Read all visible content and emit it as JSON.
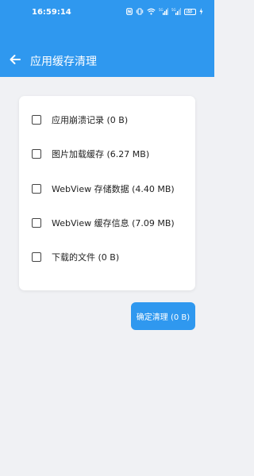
{
  "status_bar": {
    "time": "16:59:14",
    "battery": "55",
    "icons": [
      "nfc-icon",
      "vibrate-icon",
      "wifi-icon",
      "signal-1-icon",
      "signal-2-icon",
      "battery-icon",
      "charging-icon"
    ]
  },
  "header": {
    "title": "应用缓存清理",
    "back_icon": "arrow-left-icon"
  },
  "options": [
    {
      "label": "应用崩溃记录 (0 B)",
      "checked": false
    },
    {
      "label": "图片加载缓存 (6.27 MB)",
      "checked": false
    },
    {
      "label": "WebView 存储数据 (4.40 MB)",
      "checked": false
    },
    {
      "label": "WebView 缓存信息 (7.09 MB)",
      "checked": false
    },
    {
      "label": "下载的文件 (0 B)",
      "checked": false
    }
  ],
  "confirm_button": {
    "label": "确定清理 (0 B)"
  },
  "colors": {
    "accent": "#2f98ef",
    "background": "#f0f1f4"
  }
}
